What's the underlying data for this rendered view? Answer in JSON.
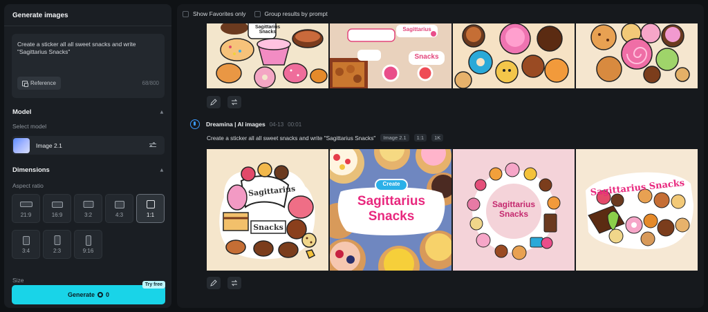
{
  "left_panel": {
    "title": "Generate images",
    "prompt_text": "Create a sticker all all sweet snacks and write \"Sagittarius Snacks\"",
    "reference_label": "Reference",
    "char_count": "68/800",
    "model_section": {
      "title": "Model",
      "select_label": "Select model",
      "model_name": "Image 2.1"
    },
    "dimensions_section": {
      "title": "Dimensions",
      "aspect_label": "Aspect ratio",
      "ratios": [
        "21:9",
        "16:9",
        "3:2",
        "4:3",
        "1:1",
        "3:4",
        "2:3",
        "9:16"
      ],
      "selected_ratio": "1:1"
    },
    "size_label": "Size",
    "generate_label": "Generate",
    "generate_cost": "0",
    "try_free_label": "Try free"
  },
  "right_panel": {
    "filters": {
      "favorites_label": "Show Favorites only",
      "group_label": "Group results by prompt"
    },
    "generation": {
      "author": "Dreamina | AI images",
      "date": "04-13",
      "time": "00:01",
      "prompt": "Create a sticker all all sweet snacks and write \"Sagittarius Snacks\"",
      "tags": [
        "Image 2.1",
        "1:1",
        "1K"
      ]
    },
    "top_images": [
      {
        "text_line1": "Sagittarius",
        "text_line2": "Snacks"
      },
      {
        "text_line1": "Sagittarius",
        "text_line2": "Snacks"
      },
      {
        "text_line1": "",
        "text_line2": ""
      },
      {
        "text_line1": "",
        "text_line2": ""
      }
    ],
    "bottom_images": [
      {
        "line1": "Sagittarius",
        "line2": "Snacks"
      },
      {
        "badge": "Create",
        "line1": "Sagittarius",
        "line2": "Snacks"
      },
      {
        "line1": "Sagittarius",
        "line2": "Snacks"
      },
      {
        "line1": "Sagittarius Snacks"
      }
    ]
  },
  "colors": {
    "accent": "#19d4e8",
    "panel_bg": "#1a1e23",
    "page_bg": "#0f1215"
  }
}
